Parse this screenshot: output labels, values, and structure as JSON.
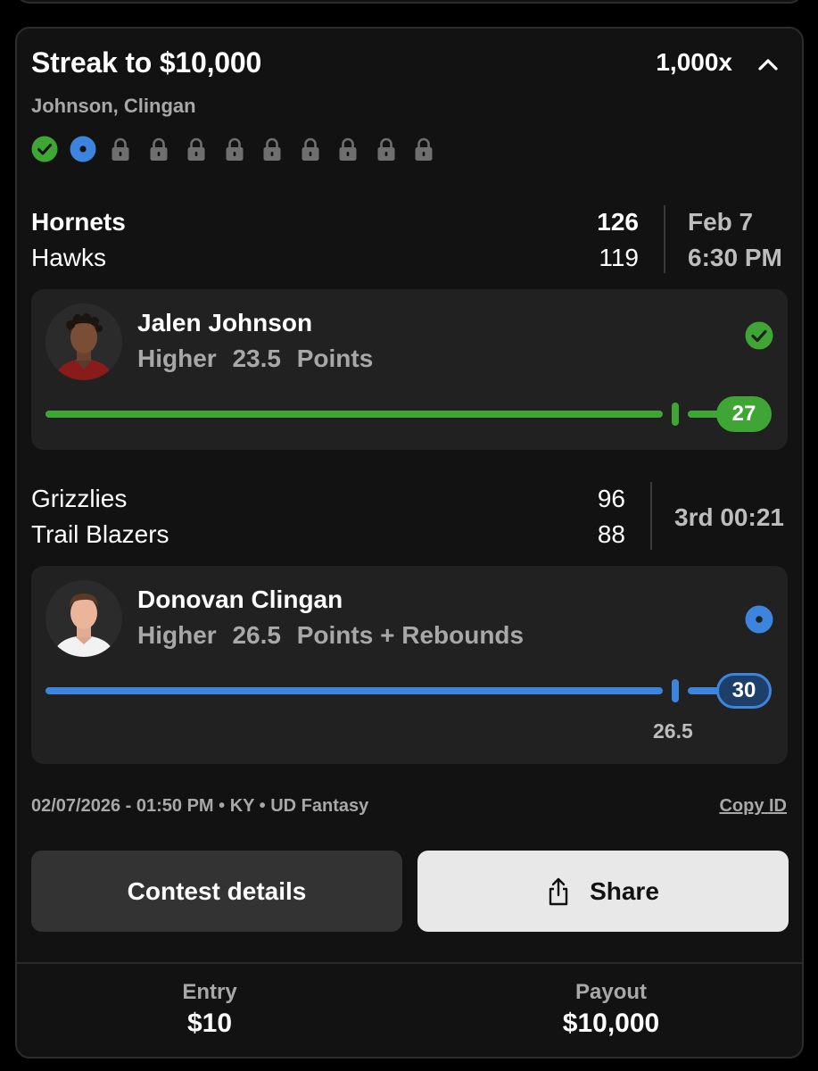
{
  "entry": {
    "title": "Streak to $10,000",
    "multiplier": "1,000x",
    "players_summary": "Johnson, Clingan",
    "streak_icons": [
      "check-circle",
      "in-progress-dot",
      "lock",
      "lock",
      "lock",
      "lock",
      "lock",
      "lock",
      "lock",
      "lock",
      "lock"
    ]
  },
  "game1": {
    "home_team": "Hornets",
    "home_score": "126",
    "away_team": "Hawks",
    "away_score": "119",
    "date": "Feb 7",
    "time": "6:30 PM"
  },
  "pick1": {
    "player": "Jalen Johnson",
    "direction": "Higher",
    "line": "23.5",
    "stat": "Points",
    "actual": "27",
    "status": "won"
  },
  "game2": {
    "home_team": "Grizzlies",
    "home_score": "96",
    "away_team": "Trail Blazers",
    "away_score": "88",
    "clock": "3rd 00:21"
  },
  "pick2": {
    "player": "Donovan Clingan",
    "direction": "Higher",
    "line": "26.5",
    "stat": "Points + Rebounds",
    "actual": "30",
    "line_label": "26.5",
    "status": "live"
  },
  "meta": {
    "info": "02/07/2026 - 01:50 PM • KY • UD Fantasy",
    "copy_id": "Copy ID"
  },
  "actions": {
    "contest_details": "Contest details",
    "share": "Share"
  },
  "footer": {
    "entry_label": "Entry",
    "entry_value": "$10",
    "payout_label": "Payout",
    "payout_value": "$10,000"
  },
  "colors": {
    "win_green": "#3fa535",
    "live_blue": "#3c84dd",
    "lock_gray": "#6f6f6f"
  }
}
